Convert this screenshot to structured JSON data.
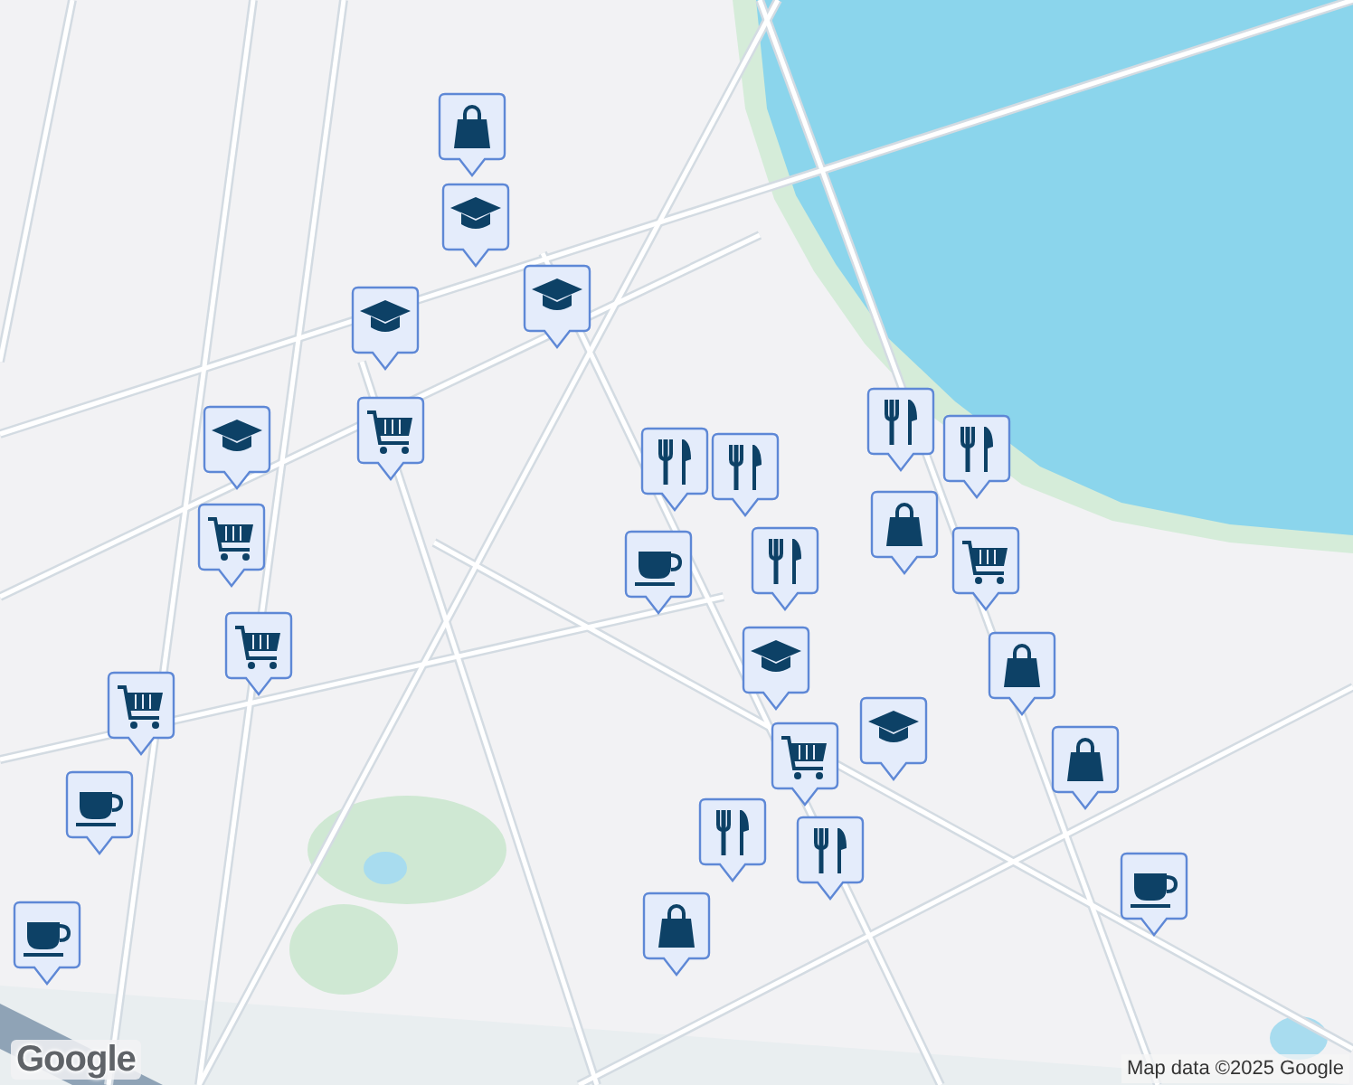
{
  "map": {
    "markers": [
      {
        "kind": "shopping"
      },
      {
        "kind": "school"
      },
      {
        "kind": "school"
      },
      {
        "kind": "school"
      },
      {
        "kind": "school"
      },
      {
        "kind": "grocery"
      },
      {
        "kind": "grocery"
      },
      {
        "kind": "grocery"
      },
      {
        "kind": "grocery"
      },
      {
        "kind": "cafe"
      },
      {
        "kind": "cafe"
      },
      {
        "kind": "restaurant"
      },
      {
        "kind": "restaurant"
      },
      {
        "kind": "cafe"
      },
      {
        "kind": "restaurant"
      },
      {
        "kind": "restaurant"
      },
      {
        "kind": "restaurant"
      },
      {
        "kind": "shopping"
      },
      {
        "kind": "grocery"
      },
      {
        "kind": "shopping"
      },
      {
        "kind": "school"
      },
      {
        "kind": "grocery"
      },
      {
        "kind": "school"
      },
      {
        "kind": "restaurant"
      },
      {
        "kind": "restaurant"
      },
      {
        "kind": "shopping"
      },
      {
        "kind": "shopping"
      },
      {
        "kind": "cafe"
      }
    ],
    "logo": "Google",
    "attribution": "Map data ©2025 Google"
  }
}
